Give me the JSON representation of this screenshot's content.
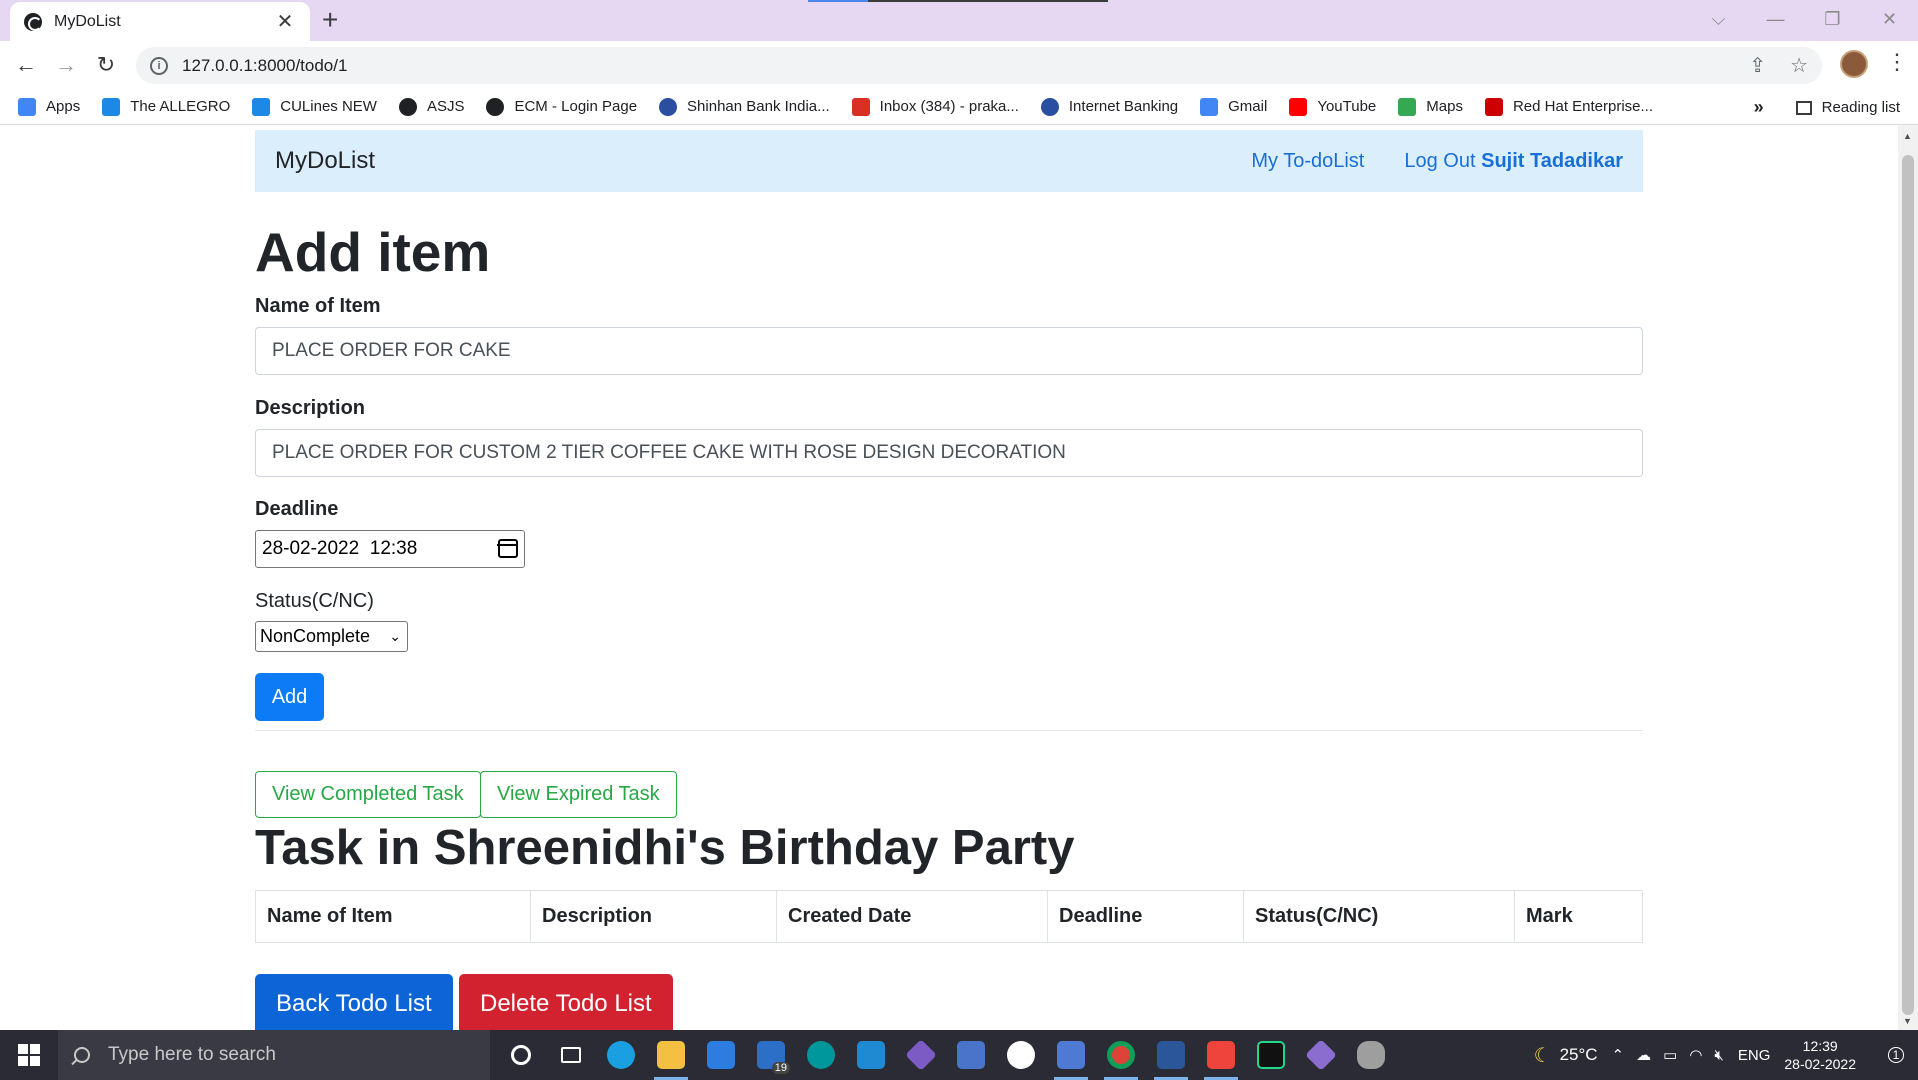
{
  "browser": {
    "tab_title": "MyDoList",
    "tab_close": "✕",
    "new_tab": "+",
    "url": "127.0.0.1:8000/todo/1",
    "window_controls": {
      "dropdown": "⌵",
      "minimize": "—",
      "restore": "❐",
      "close": "✕"
    },
    "bookmarks": [
      {
        "label": "Apps",
        "icon": "apps-grid-icon",
        "color": "#4285f4"
      },
      {
        "label": "The ALLEGRO",
        "icon": "allegro-icon",
        "color": "#1e88e5"
      },
      {
        "label": "CULines NEW",
        "icon": "culines-icon",
        "color": "#1e88e5"
      },
      {
        "label": "ASJS",
        "icon": "globe-icon",
        "color": "#202124"
      },
      {
        "label": "ECM - Login Page",
        "icon": "globe-icon",
        "color": "#202124"
      },
      {
        "label": "Shinhan Bank India...",
        "icon": "shinhan-icon",
        "color": "#2a4fa0"
      },
      {
        "label": "Inbox (384) - praka...",
        "icon": "gmail-icon",
        "color": "#d93025"
      },
      {
        "label": "Internet Banking",
        "icon": "bank-icon",
        "color": "#2a4fa0"
      },
      {
        "label": "Gmail",
        "icon": "google-icon",
        "color": "#4285f4"
      },
      {
        "label": "YouTube",
        "icon": "youtube-icon",
        "color": "#ff0000"
      },
      {
        "label": "Maps",
        "icon": "maps-icon",
        "color": "#34a853"
      },
      {
        "label": "Red Hat Enterprise...",
        "icon": "redhat-icon",
        "color": "#cc0000"
      }
    ],
    "more_bookmarks": "»",
    "reading_list": "Reading list"
  },
  "navbar": {
    "brand": "MyDoList",
    "link_todo": "My To-doList",
    "link_logout": "Log Out",
    "username": "Sujit Tadadikar"
  },
  "form": {
    "heading": "Add item",
    "name_label": "Name of Item",
    "name_value": "PLACE ORDER FOR  CAKE",
    "desc_label": "Description",
    "desc_value": "PLACE ORDER FOR CUSTOM 2 TIER COFFEE CAKE WITH ROSE DESIGN  DECORATION",
    "deadline_label": "Deadline",
    "deadline_value": "28-02-2022  12:38",
    "status_label": "Status(C/NC)",
    "status_value": "NonComplete",
    "add_button": "Add"
  },
  "actions": {
    "view_completed": "View Completed Task",
    "view_expired": "View Expired Task"
  },
  "list": {
    "heading": "Task in Shreenidhi's Birthday Party",
    "columns": [
      "Name of Item",
      "Description",
      "Created Date",
      "Deadline",
      "Status(C/NC)",
      "Mark"
    ],
    "back_button": "Back Todo List",
    "delete_button": "Delete Todo List"
  },
  "taskbar": {
    "search_placeholder": "Type here to search",
    "temperature": "25°C",
    "language": "ENG",
    "time": "12:39",
    "date": "28-02-2022",
    "mail_badge": "19",
    "notification_count": "1"
  }
}
